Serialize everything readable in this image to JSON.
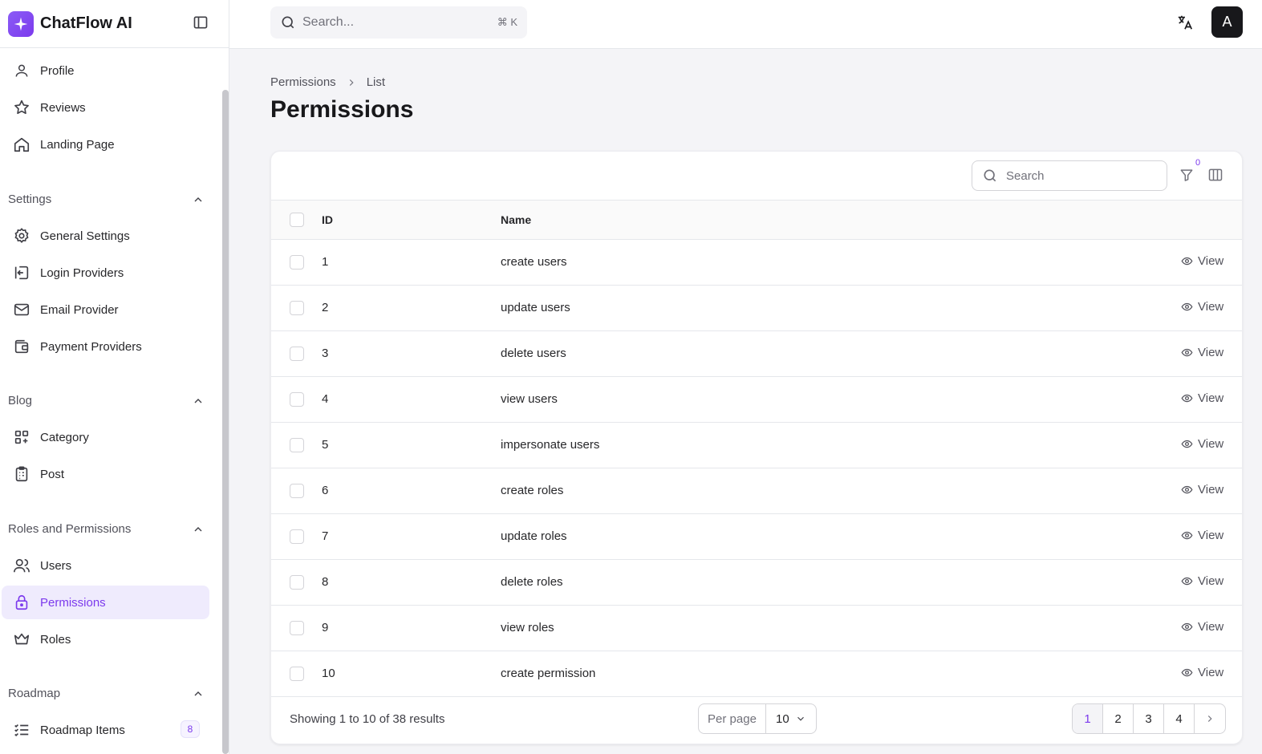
{
  "app": {
    "name": "ChatFlow AI"
  },
  "topbar": {
    "search_placeholder": "Search...",
    "search_shortcut": "⌘ K",
    "avatar_initial": "A"
  },
  "sidebar": {
    "top_items": [
      {
        "label": "Profile",
        "icon": "user-icon"
      },
      {
        "label": "Reviews",
        "icon": "star-icon"
      },
      {
        "label": "Landing Page",
        "icon": "home-icon"
      }
    ],
    "groups": [
      {
        "title": "Settings",
        "items": [
          {
            "label": "General Settings",
            "icon": "gear-icon"
          },
          {
            "label": "Login Providers",
            "icon": "login-icon"
          },
          {
            "label": "Email Provider",
            "icon": "mail-icon"
          },
          {
            "label": "Payment Providers",
            "icon": "wallet-icon"
          }
        ]
      },
      {
        "title": "Blog",
        "items": [
          {
            "label": "Category",
            "icon": "category-icon"
          },
          {
            "label": "Post",
            "icon": "clipboard-icon"
          }
        ]
      },
      {
        "title": "Roles and Permissions",
        "items": [
          {
            "label": "Users",
            "icon": "users-icon"
          },
          {
            "label": "Permissions",
            "icon": "lock-icon",
            "active": true
          },
          {
            "label": "Roles",
            "icon": "crown-icon"
          }
        ]
      },
      {
        "title": "Roadmap",
        "items": [
          {
            "label": "Roadmap Items",
            "icon": "list-icon",
            "badge": "8"
          }
        ]
      }
    ]
  },
  "breadcrumb": {
    "parent": "Permissions",
    "current": "List"
  },
  "page": {
    "title": "Permissions"
  },
  "table": {
    "search_placeholder": "Search",
    "filter_count": "0",
    "columns": {
      "id": "ID",
      "name": "Name"
    },
    "view_label": "View",
    "rows": [
      {
        "id": "1",
        "name": "create users"
      },
      {
        "id": "2",
        "name": "update users"
      },
      {
        "id": "3",
        "name": "delete users"
      },
      {
        "id": "4",
        "name": "view users"
      },
      {
        "id": "5",
        "name": "impersonate users"
      },
      {
        "id": "6",
        "name": "create roles"
      },
      {
        "id": "7",
        "name": "update roles"
      },
      {
        "id": "8",
        "name": "delete roles"
      },
      {
        "id": "9",
        "name": "view roles"
      },
      {
        "id": "10",
        "name": "create permission"
      }
    ],
    "footer": {
      "showing": "Showing 1 to 10 of 38 results",
      "per_page_label": "Per page",
      "per_page_value": "10",
      "pages": [
        "1",
        "2",
        "3",
        "4"
      ],
      "current_page": "1"
    }
  },
  "colors": {
    "accent": "#7c3aed",
    "active_bg": "#efebfd"
  }
}
